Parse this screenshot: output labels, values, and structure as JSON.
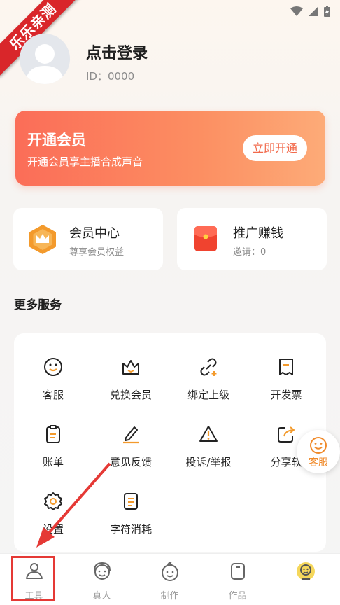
{
  "watermark": "乐乐亲测",
  "profile": {
    "title": "点击登录",
    "id_text": "ID：0000"
  },
  "vip": {
    "title": "开通会员",
    "subtitle": "开通会员享主播合成声音",
    "button": "立即开通"
  },
  "cards": [
    {
      "title": "会员中心",
      "subtitle": "尊享会员权益",
      "icon": "crown-hexagon-icon"
    },
    {
      "title": "推广赚钱",
      "subtitle": "邀请：0",
      "icon": "red-envelope-icon"
    }
  ],
  "services_title": "更多服务",
  "services": [
    {
      "label": "客服",
      "icon": "smiley-icon"
    },
    {
      "label": "兑换会员",
      "icon": "crown-icon"
    },
    {
      "label": "绑定上级",
      "icon": "link-icon"
    },
    {
      "label": "开发票",
      "icon": "receipt-icon"
    },
    {
      "label": "账单",
      "icon": "clipboard-icon"
    },
    {
      "label": "意见反馈",
      "icon": "pencil-icon"
    },
    {
      "label": "投诉/举报",
      "icon": "warning-icon"
    },
    {
      "label": "分享软",
      "icon": "share-icon"
    },
    {
      "label": "设置",
      "icon": "gear-icon"
    },
    {
      "label": "字符消耗",
      "icon": "document-icon"
    }
  ],
  "float_service": {
    "label": "客服",
    "icon": "smiley-icon"
  },
  "tabs": [
    {
      "label": "工具",
      "icon": "person-icon",
      "active": true
    },
    {
      "label": "真人",
      "icon": "headset-face-icon"
    },
    {
      "label": "制作",
      "icon": "face-icon"
    },
    {
      "label": "作品",
      "icon": "square-icon"
    },
    {
      "label": "",
      "icon": "avatar-badge-icon"
    }
  ],
  "colors": {
    "accent": "#f26a4c",
    "orange": "#f39a2c",
    "annotation": "#e53935"
  }
}
